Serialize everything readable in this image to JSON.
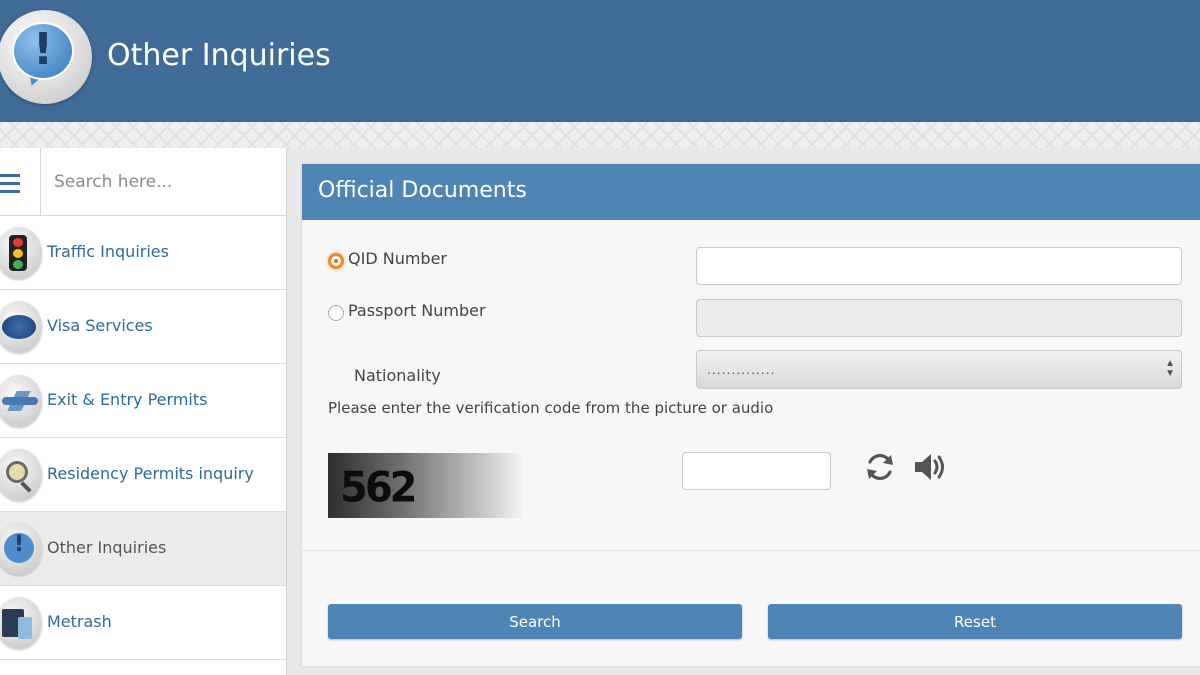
{
  "header": {
    "title": "Other Inquiries",
    "icon": "exclamation-bubble-icon"
  },
  "sidebar": {
    "search_placeholder": "Search here...",
    "items": [
      {
        "label": "Traffic Inquiries",
        "icon": "traffic-light-icon",
        "active": false
      },
      {
        "label": "Visa Services",
        "icon": "visa-plane-icon",
        "active": false
      },
      {
        "label": "Exit & Entry Permits",
        "icon": "airplane-icon",
        "active": false
      },
      {
        "label": "Residency Permits inquiry",
        "icon": "magnifier-icon",
        "active": false
      },
      {
        "label": "Other Inquiries",
        "icon": "exclamation-bubble-icon",
        "active": true
      },
      {
        "label": "Metrash",
        "icon": "metrash-device-icon",
        "active": false
      }
    ]
  },
  "panel": {
    "title": "Official Documents",
    "qid_label": "QID Number",
    "qid_value": "",
    "passport_label": "Passport Number",
    "passport_value": "",
    "nationality_label": "Nationality",
    "nationality_value": "..............",
    "verification_text": "Please enter the verification code from the picture or audio",
    "captcha_text": "562",
    "captcha_input_value": "",
    "search_label": "Search",
    "reset_label": "Reset"
  },
  "colors": {
    "header": "#3f6b96",
    "accent": "#4f85b5",
    "link": "#2f6a98",
    "radio_checked": "#f08a2c"
  }
}
